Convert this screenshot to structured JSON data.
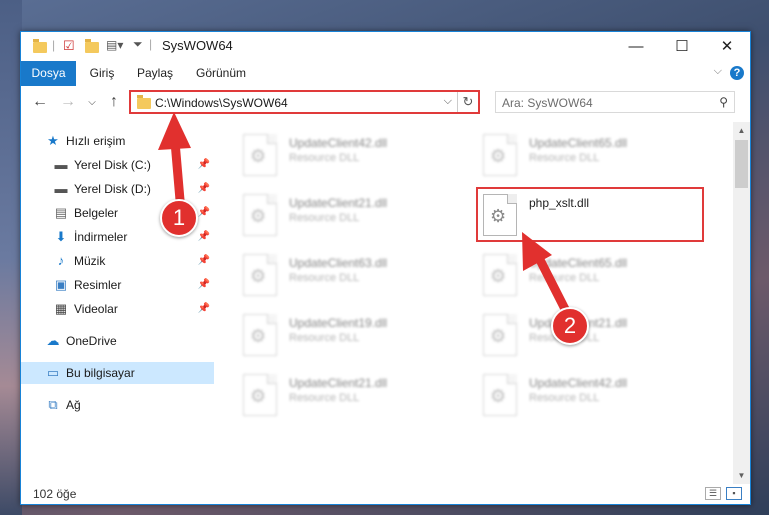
{
  "window": {
    "title": "SysWOW64",
    "minimize_icon": "minimize-icon",
    "maximize_icon": "maximize-icon",
    "close_icon": "close-icon"
  },
  "ribbon": {
    "tabs": [
      "Dosya",
      "Giriş",
      "Paylaş",
      "Görünüm"
    ],
    "active_tab": "Dosya",
    "accent": "#1979ca"
  },
  "address": {
    "path": "C:\\Windows\\SysWOW64",
    "search_placeholder": "Ara: SysWOW64"
  },
  "sidebar": {
    "items": [
      {
        "label": "Hızlı erişim",
        "icon": "star-icon",
        "pinned": false
      },
      {
        "label": "Yerel Disk (C:)",
        "icon": "drive-icon",
        "pinned": true
      },
      {
        "label": "Yerel Disk (D:)",
        "icon": "drive-icon",
        "pinned": true
      },
      {
        "label": "Belgeler",
        "icon": "document-icon",
        "pinned": true
      },
      {
        "label": "İndirmeler",
        "icon": "download-icon",
        "pinned": true
      },
      {
        "label": "Müzik",
        "icon": "music-icon",
        "pinned": true
      },
      {
        "label": "Resimler",
        "icon": "pictures-icon",
        "pinned": true
      },
      {
        "label": "Videolar",
        "icon": "video-icon",
        "pinned": true
      },
      {
        "label": "OneDrive",
        "icon": "cloud-icon",
        "pinned": false
      },
      {
        "label": "Bu bilgisayar",
        "icon": "computer-icon",
        "pinned": false,
        "selected": true
      },
      {
        "label": "Ağ",
        "icon": "network-icon",
        "pinned": false
      }
    ]
  },
  "files": [
    {
      "name": "UpdateClient42.dll",
      "type": "Resource DLL"
    },
    {
      "name": "UpdateClient65.dll",
      "type": "Resource DLL"
    },
    {
      "name": "UpdateClient21.dll",
      "type": "Resource DLL"
    },
    {
      "name": "php_xslt.dll",
      "type": ""
    },
    {
      "name": "UpdateClient63.dll",
      "type": "Resource DLL"
    },
    {
      "name": "UpdateClient65.dll",
      "type": "Resource DLL"
    },
    {
      "name": "UpdateClient19.dll",
      "type": "Resource DLL"
    },
    {
      "name": "UpdateClient21.dll",
      "type": "Resource DLL"
    },
    {
      "name": "UpdateClient21.dll",
      "type": "Resource DLL"
    },
    {
      "name": "UpdateClient42.dll",
      "type": "Resource DLL"
    }
  ],
  "status": {
    "item_count": "102 öğe"
  },
  "annotations": {
    "step1": "1",
    "step2": "2",
    "color": "#e1302e"
  }
}
